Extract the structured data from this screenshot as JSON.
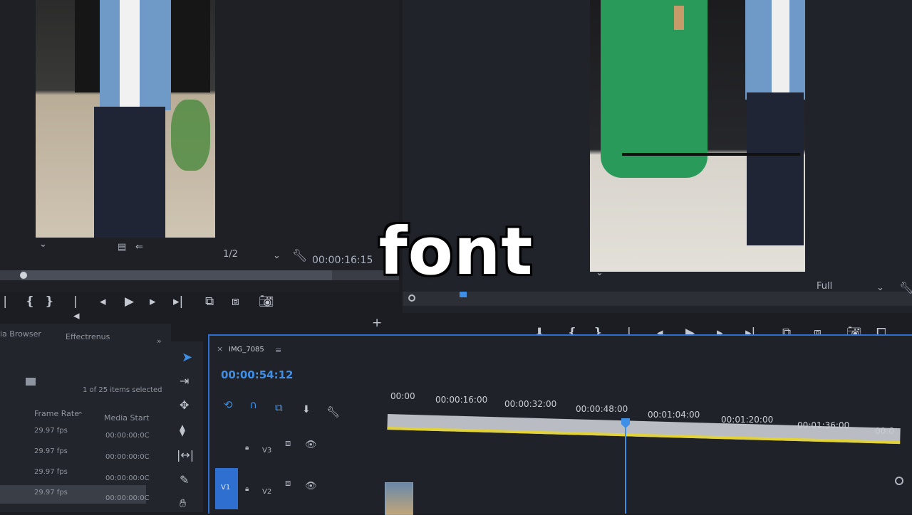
{
  "source_monitor": {
    "fraction": "1/2",
    "timecode": "00:00:16:15"
  },
  "program_monitor": {
    "quality": "Full"
  },
  "project_panel": {
    "tabs": [
      "ia Browser",
      "Effectrenus"
    ],
    "items_selected": "1 of 25 items selected",
    "columns": [
      "Frame Rate",
      "Media Start"
    ],
    "rows": [
      {
        "frame_rate": "29.97 fps",
        "media_start": "00:00:00:0C"
      },
      {
        "frame_rate": "29.97 fps",
        "media_start": "00:00:00:0C"
      },
      {
        "frame_rate": "29.97 fps",
        "media_start": "00:00:00:0C"
      },
      {
        "frame_rate": "29.97 fps",
        "media_start": "00:00:00:0C"
      }
    ]
  },
  "timeline": {
    "sequence_name": "IMG_7085",
    "playhead_timecode": "00:00:54:12",
    "ruler": [
      "00:00",
      "00:00:16:00",
      "00:00:32:00",
      "00:00:48:00",
      "00:01:04:00",
      "00:01:20:00",
      "00:01:36:00",
      "00:0"
    ],
    "tracks": [
      {
        "label": "V3"
      },
      {
        "label": "V2"
      }
    ],
    "v1_label": "V1"
  },
  "caption": "font",
  "colors": {
    "accent": "#2f6fd0",
    "work_area": "#e2d23a",
    "timecode": "#3f8fe6"
  }
}
